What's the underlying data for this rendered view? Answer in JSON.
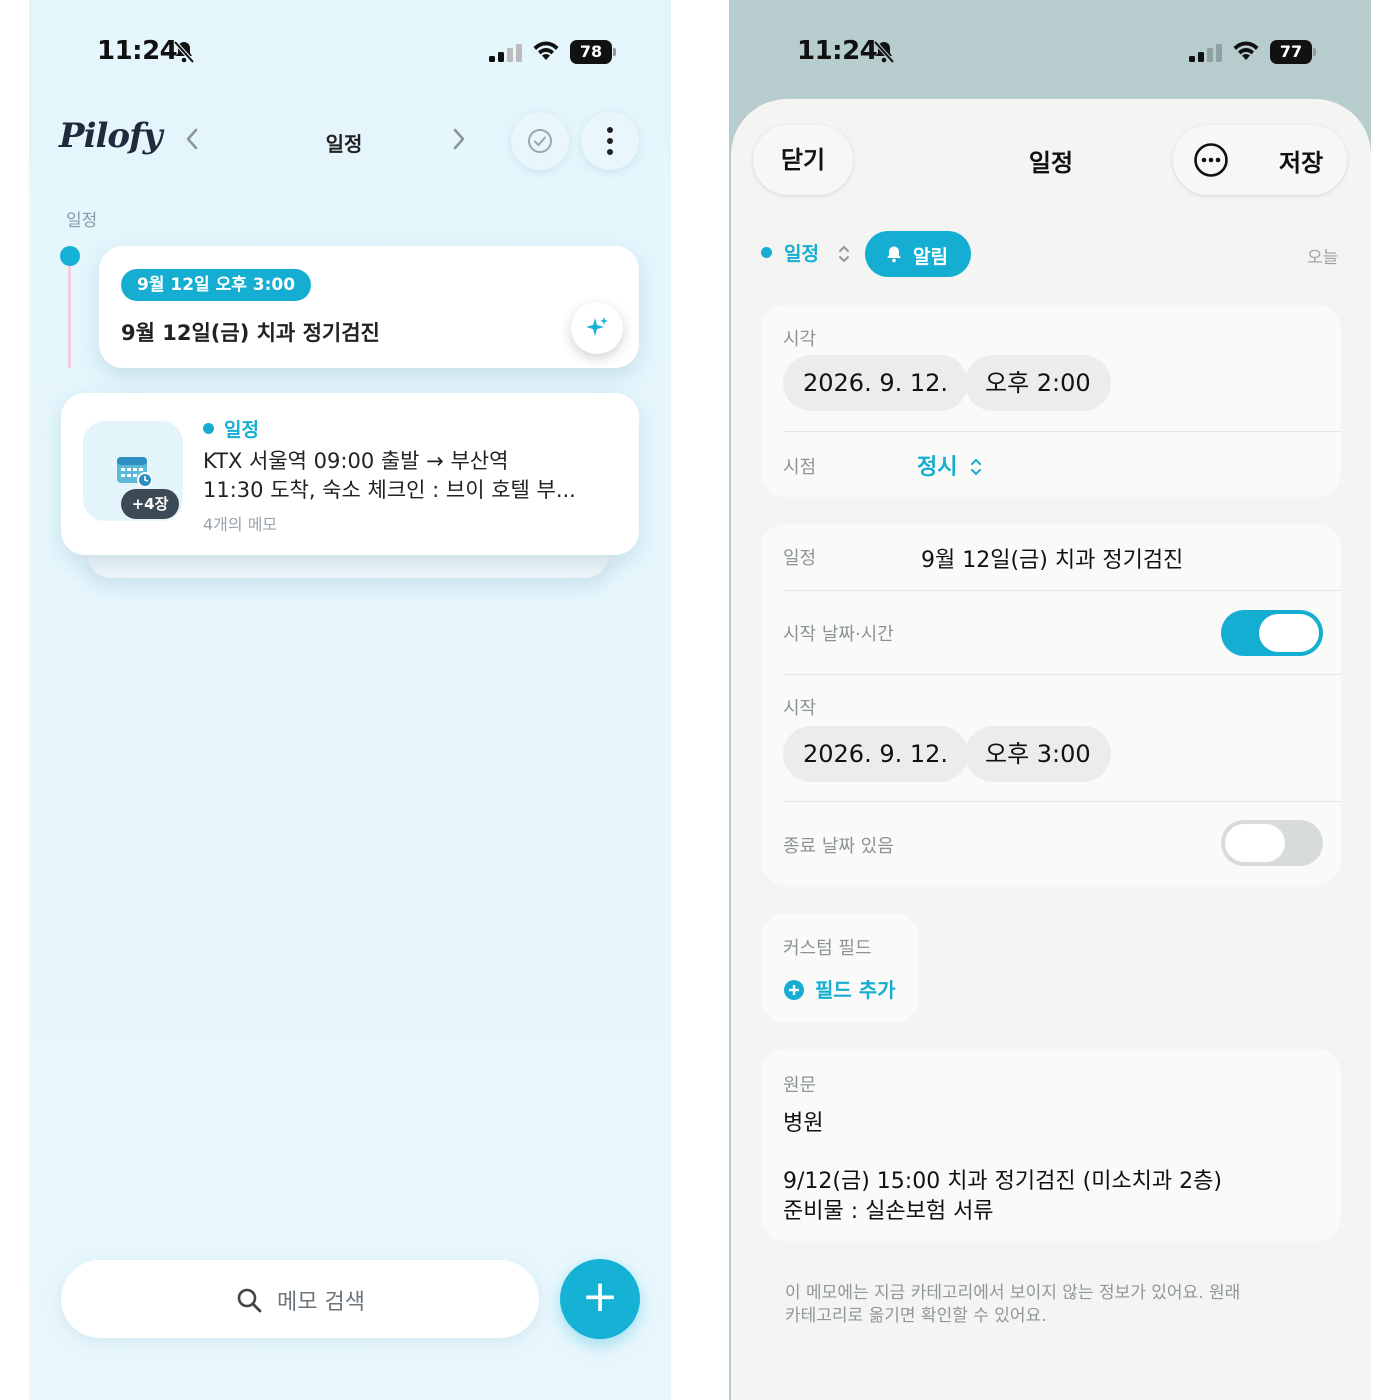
{
  "left": {
    "status": {
      "time": "11:24",
      "battery": "78"
    },
    "header": {
      "logo": "Pilofy",
      "title": "일정"
    },
    "section_label": "일정",
    "card1": {
      "date_pill": "9월 12일 오후 3:00",
      "title": "9월 12일(금) 치과 정기검진"
    },
    "card2": {
      "category": "일정",
      "line1": "KTX 서울역 09:00 출발 → 부산역",
      "line2": "11:30 도착, 숙소 체크인 : 브이 호텔 부...",
      "sub": "4개의 메모",
      "badge": "+4장"
    },
    "search": {
      "placeholder": "메모 검색"
    },
    "fab": "+"
  },
  "right": {
    "status": {
      "time": "11:24",
      "battery": "77"
    },
    "header": {
      "close": "닫기",
      "title": "일정",
      "save": "저장"
    },
    "chips": {
      "category": "일정",
      "alarm": "알림",
      "today": "오늘"
    },
    "time_group": {
      "label": "시각",
      "date": "2026. 9. 12.",
      "time": "오후 2:00",
      "point_label": "시점",
      "point_value": "정시"
    },
    "event_group": {
      "event_label": "일정",
      "event_value": "9월 12일(금) 치과 정기검진",
      "start_toggle_label": "시작 날짜·시간",
      "start_toggle_on": true,
      "start_label": "시작",
      "start_date": "2026. 9. 12.",
      "start_time": "오후 3:00",
      "end_toggle_label": "종료 날짜 있음",
      "end_toggle_on": false
    },
    "custom": {
      "label": "커스텀 필드",
      "add": "필드 추가"
    },
    "original": {
      "label": "원문",
      "line1": "병원",
      "line2": "9/12(금) 15:00 치과 정기검진 (미소치과 2층)",
      "line3": "준비물 : 실손보험 서류"
    },
    "footnote_line1": "이 메모에는 지금 카테고리에서 보이지 않는 정보가 있어요. 원래",
    "footnote_line2": "카테고리로 옮기면 확인할 수 있어요."
  },
  "colors": {
    "accent": "#15aed2",
    "left_bg": "#e4f6fc",
    "right_bg": "#b6cccd"
  }
}
